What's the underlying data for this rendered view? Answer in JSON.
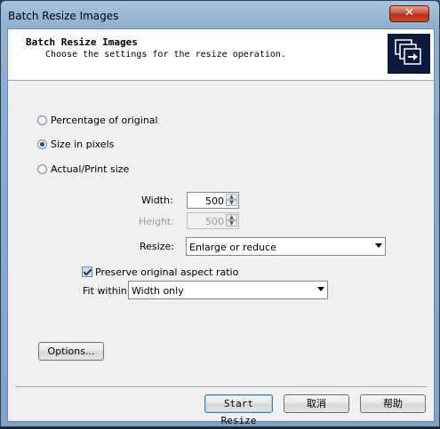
{
  "window": {
    "title": "Batch Resize Images",
    "close_symbol": "✕"
  },
  "header": {
    "title": "Batch Resize Images",
    "subtitle": "Choose the settings for the resize operation.",
    "icon": "batch-resize-icon"
  },
  "mode": {
    "options": [
      {
        "label": "Percentage of original",
        "selected": false
      },
      {
        "label": "Size in pixels",
        "selected": true
      },
      {
        "label": "Actual/Print size",
        "selected": false
      }
    ]
  },
  "size": {
    "width_label": "Width:",
    "width_value": "500",
    "height_label": "Height:",
    "height_value": "500",
    "resize_label": "Resize:",
    "resize_value": "Enlarge or reduce"
  },
  "aspect": {
    "preserve_label": "Preserve original aspect ratio",
    "preserve_checked": true,
    "fit_label": "Fit within:",
    "fit_value": "Width only"
  },
  "buttons": {
    "options": "Options...",
    "start": "Start Resize",
    "cancel": "取消",
    "help": "帮助"
  }
}
